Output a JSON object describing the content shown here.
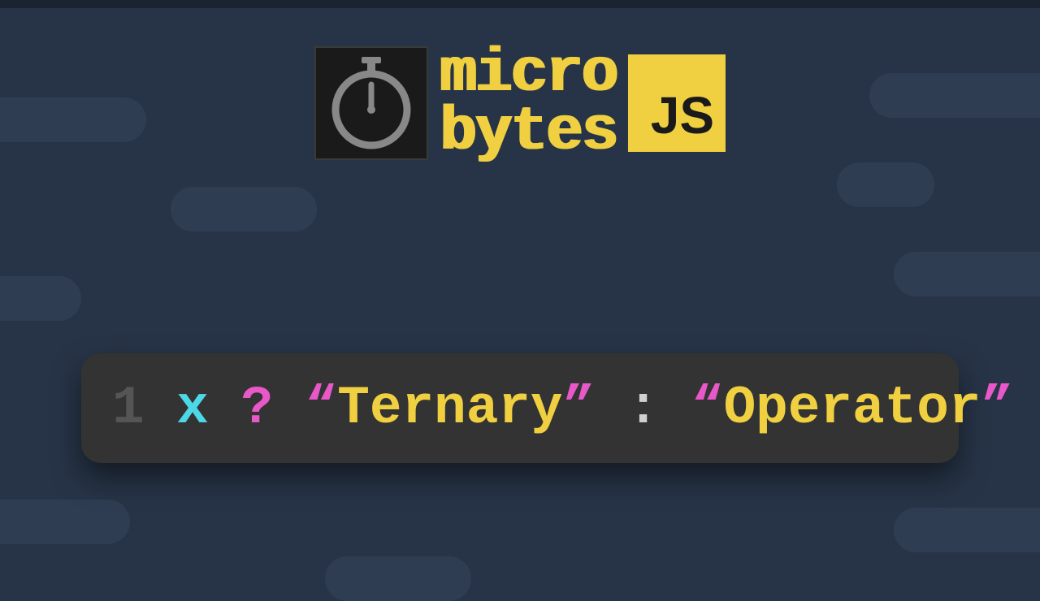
{
  "logo": {
    "word1": "micro",
    "word2": "bytes",
    "badge": "JS"
  },
  "code": {
    "line_number": "1",
    "variable": "x",
    "question": "?",
    "open_quote_1": "“",
    "string_1": "Ternary",
    "close_quote_1": "”",
    "colon": ":",
    "open_quote_2": "“",
    "string_2": "Operator",
    "close_quote_2": "”"
  },
  "colors": {
    "background": "#273447",
    "shape": "#2e3d52",
    "code_bg": "#333333",
    "yellow": "#f0d040",
    "cyan": "#4dd8e8",
    "magenta": "#e858c8",
    "gray": "#d0d0d0"
  }
}
